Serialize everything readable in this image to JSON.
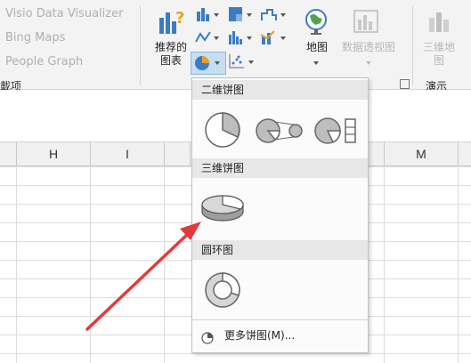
{
  "ribbon": {
    "addins": [
      "Visio Data Visualizer",
      "Bing Maps",
      "People Graph"
    ],
    "addins_group_label": "載项",
    "recommended_charts": "推荐的\n图表",
    "maps": "地图",
    "pivot_chart": "数据透视图",
    "map3d": "三维地\n图",
    "tours_group_label": "演示"
  },
  "columns": [
    "H",
    "I",
    "M"
  ],
  "menu": {
    "sections": [
      {
        "title": "二维饼图",
        "options": [
          "pie",
          "pie-of-pie",
          "bar-of-pie"
        ]
      },
      {
        "title": "三维饼图",
        "options": [
          "3d-pie"
        ]
      },
      {
        "title": "圆环图",
        "options": [
          "doughnut"
        ]
      }
    ],
    "more_charts": "更多饼图(M)..."
  },
  "colors": {
    "arrow": "#e23b3b",
    "highlight": "#c7ddf2"
  }
}
